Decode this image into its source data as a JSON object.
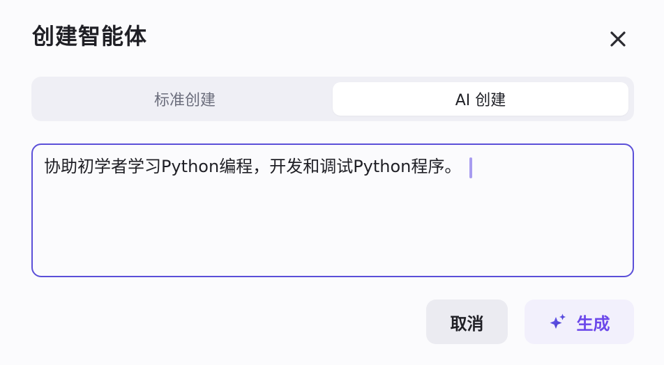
{
  "dialog": {
    "title": "创建智能体",
    "close_icon": "close-icon"
  },
  "tabs": [
    {
      "label": "标准创建",
      "active": false
    },
    {
      "label": "AI 创建",
      "active": true
    }
  ],
  "prompt": {
    "value": "协助初学者学习Python编程，开发和调试Python程序。",
    "border_color": "#5b4fd8"
  },
  "actions": {
    "cancel_label": "取消",
    "generate_label": "生成",
    "generate_icon": "sparkle-icon",
    "accent_color": "#6b47ea"
  }
}
